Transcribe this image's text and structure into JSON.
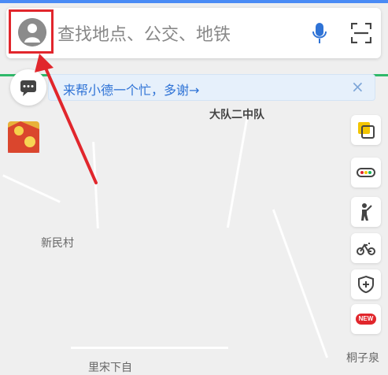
{
  "search": {
    "placeholder": "查找地点、公交、地铁"
  },
  "banner": {
    "text": "来帮小德一个忙，多谢→",
    "close": "×"
  },
  "map_labels": {
    "team": "大队二中队",
    "village": "新民村",
    "bottom_right": "桐子泉",
    "bottom_center": "里宋下自"
  },
  "side_buttons": {
    "new_badge": "NEW"
  },
  "colors": {
    "accent_blue": "#2f73d6",
    "highlight_red": "#e1262c",
    "route_green": "#1bb35b"
  },
  "icons": [
    "avatar-icon",
    "microphone-icon",
    "scan-icon",
    "chat-icon",
    "layers-icon",
    "traffic-icon",
    "pedestrian-icon",
    "bike-icon",
    "shield-icon",
    "new-badge-icon",
    "close-icon"
  ]
}
